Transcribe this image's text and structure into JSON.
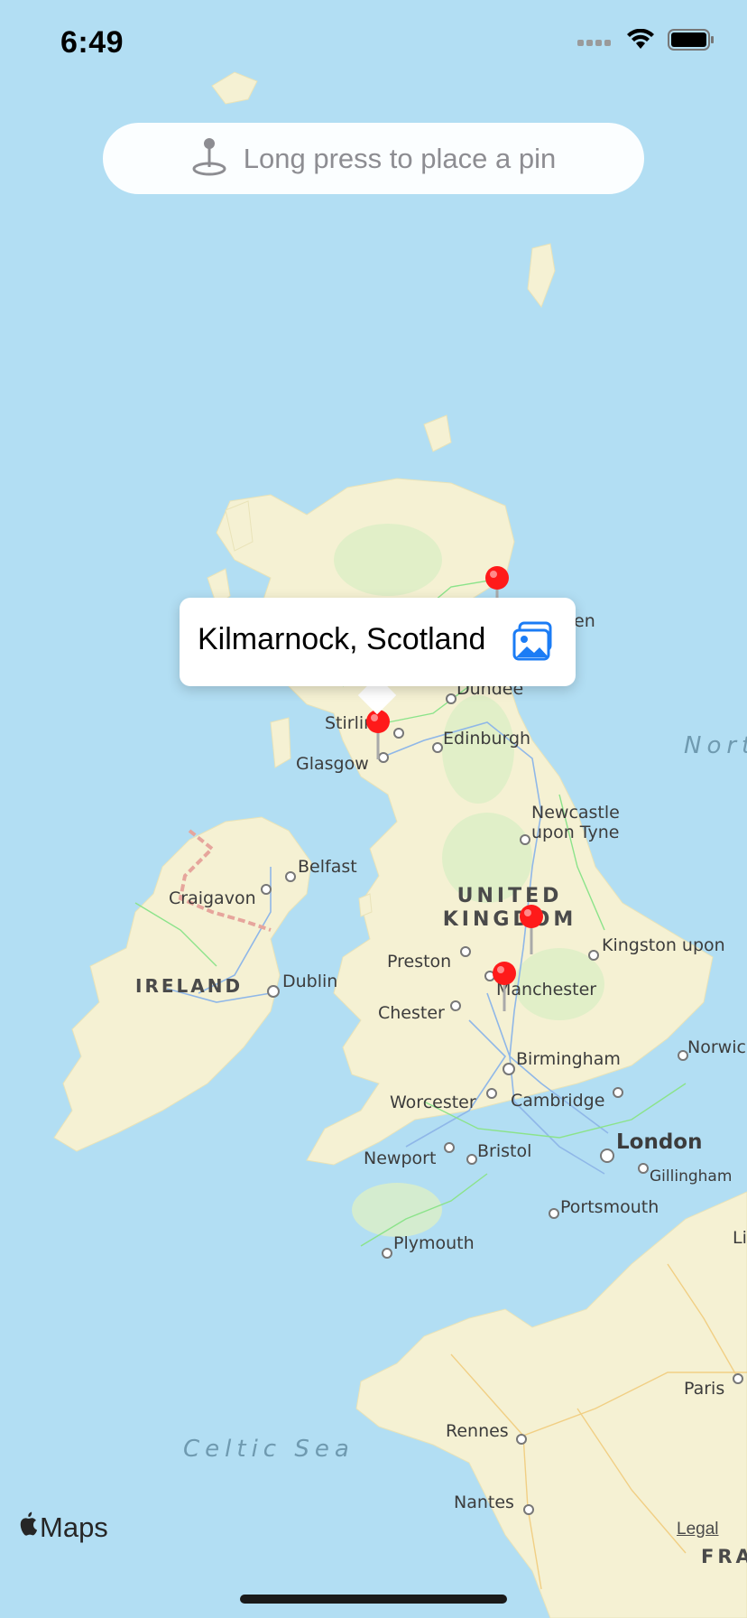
{
  "status": {
    "time": "6:49"
  },
  "search": {
    "placeholder": "Long press to place a pin",
    "icon": "pin-drop-icon"
  },
  "callout": {
    "title": "Kilmarnock, Scotland",
    "icon": "photo-gallery-icon"
  },
  "map": {
    "water_color": "#b2def3",
    "land_color": "#f6f2d6",
    "labels": {
      "aberdeen_partial": "en",
      "dundee": "Dundee",
      "stirling": "Stirling",
      "edinburgh": "Edinburgh",
      "glasgow": "Glasgow",
      "newcastle": "Newcastle upon Tyne",
      "belfast": "Belfast",
      "craigavon": "Craigavon",
      "united_kingdom": "UNITED KINGDOM",
      "kingston": "Kingston upon",
      "preston": "Preston",
      "ireland": "IRELAND",
      "dublin": "Dublin",
      "manchester": "Manchester",
      "chester": "Chester",
      "norwich": "Norwic",
      "birmingham": "Birmingham",
      "worcester": "Worcester",
      "cambridge": "Cambridge",
      "london": "London",
      "newport": "Newport",
      "bristol": "Bristol",
      "gillingham": "Gillingham",
      "portsmouth": "Portsmouth",
      "plymouth": "Plymouth",
      "celtic_sea": "Celtic Sea",
      "north_sea_partial": "Nort",
      "paris": "Paris",
      "li_partial": "Li",
      "rennes": "Rennes",
      "nantes": "Nantes",
      "france_partial": "FRA"
    }
  },
  "pins": [
    {
      "name": "Kilmarnock",
      "color": "#ff1a1a"
    },
    {
      "name": "Aberdeen area",
      "color": "#ff1a1a"
    },
    {
      "name": "Yorkshire",
      "color": "#ff1a1a"
    },
    {
      "name": "Manchester",
      "color": "#ff1a1a"
    }
  ],
  "footer": {
    "maps_brand": "Maps",
    "legal": "Legal"
  }
}
